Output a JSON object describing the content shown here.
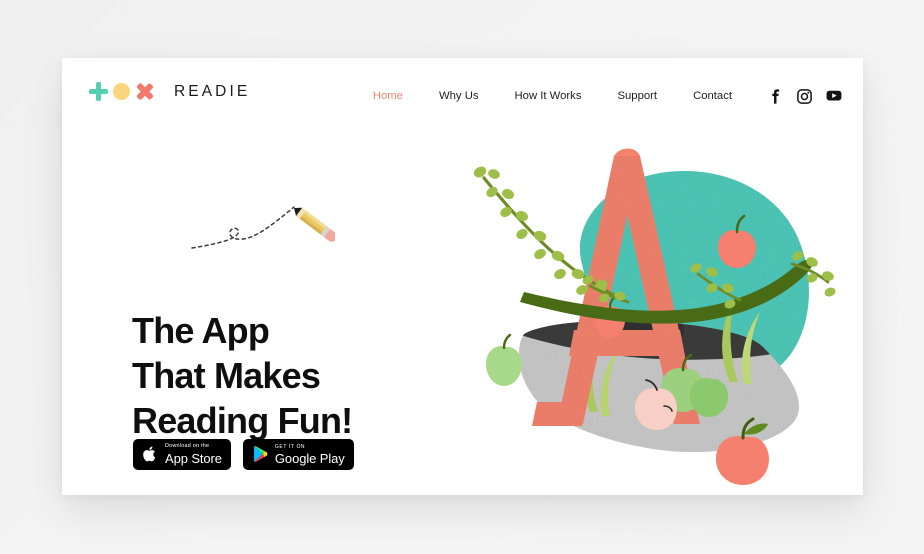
{
  "page": {
    "background_color": "#f2f2f2",
    "card_background": "#ffffff"
  },
  "brand": {
    "name": "READIE",
    "mark": {
      "plus_icon": "plus-icon",
      "plus_color": "#54cfb0",
      "circle_icon": "circle-icon",
      "circle_color": "#fad57c",
      "x_icon": "x-icon",
      "x_color": "#f0796a"
    }
  },
  "nav": {
    "items": [
      {
        "label": "Home",
        "active": true
      },
      {
        "label": "Why Us",
        "active": false
      },
      {
        "label": "How It Works",
        "active": false
      },
      {
        "label": "Support",
        "active": false
      },
      {
        "label": "Contact",
        "active": false
      }
    ],
    "active_color": "#f3836f",
    "text_color": "#1e1e1e",
    "social": [
      {
        "name": "facebook-icon",
        "label": "Facebook"
      },
      {
        "name": "instagram-icon",
        "label": "Instagram"
      },
      {
        "name": "youtube-icon",
        "label": "YouTube"
      }
    ]
  },
  "hero": {
    "headline_lines": [
      "The App",
      "That Makes",
      "Reading Fun!"
    ],
    "headline_color": "#0f0f0f",
    "doodle": {
      "name": "pencil-doodle",
      "pencil_body_color": "#e8c86a",
      "pencil_eraser_color": "#f0a9a0",
      "trail_style": "dashed"
    },
    "badges": [
      {
        "icon": "apple-logo-icon",
        "small_text": "Download on the",
        "big_text": "App Store"
      },
      {
        "icon": "google-play-icon",
        "small_text": "GET IT ON",
        "big_text": "Google Play"
      }
    ],
    "illustration": {
      "name": "letter-a-apple-scene",
      "letter": "A",
      "letter_color": "#f4836e",
      "blob_color": "#4fcbbb",
      "ground_color": "#c9c9c9",
      "hill_color": "#3a3a3a",
      "branch_color": "#4a6b16",
      "leaf_color": "#9dbf4a",
      "apple_red_color": "#f5806f",
      "apple_green_color": "#a8d88a",
      "apple_pink_color": "#f7cfc4",
      "grass_color": "#a9c95f"
    }
  }
}
